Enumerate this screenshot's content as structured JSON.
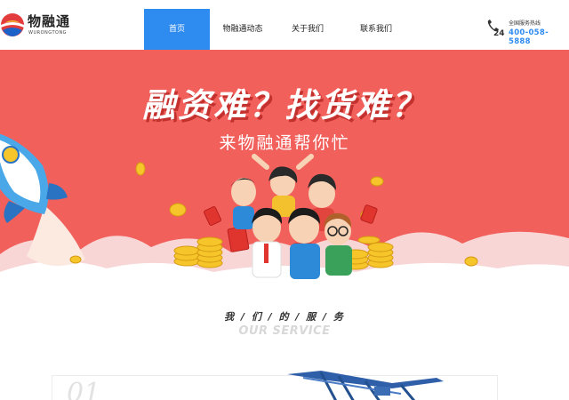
{
  "logo": {
    "name": "物融通",
    "sub": "WURONGTONG"
  },
  "nav": {
    "items": [
      {
        "label": "首页",
        "active": true
      },
      {
        "label": "物融通动态",
        "active": false
      },
      {
        "label": "关于我们",
        "active": false
      },
      {
        "label": "联系我们",
        "active": false
      }
    ]
  },
  "hotline": {
    "icon_text": "24",
    "label": "全国服务热线",
    "number": "400-058-5888"
  },
  "banner": {
    "headline": "融资难？找货难？",
    "subline": "来物融通帮你忙"
  },
  "service": {
    "title": "我 / 们 / 的 / 服 / 务",
    "subtitle": "OUR SERVICE"
  },
  "card": {
    "number": "01"
  },
  "colors": {
    "accent": "#2e8bf0",
    "banner_bg": "#f2605c",
    "coin": "#f5c52a"
  },
  "icons": [
    "logo-mark-icon",
    "phone-24h-icon",
    "rocket-icon",
    "coin-icon",
    "crane-icon"
  ]
}
